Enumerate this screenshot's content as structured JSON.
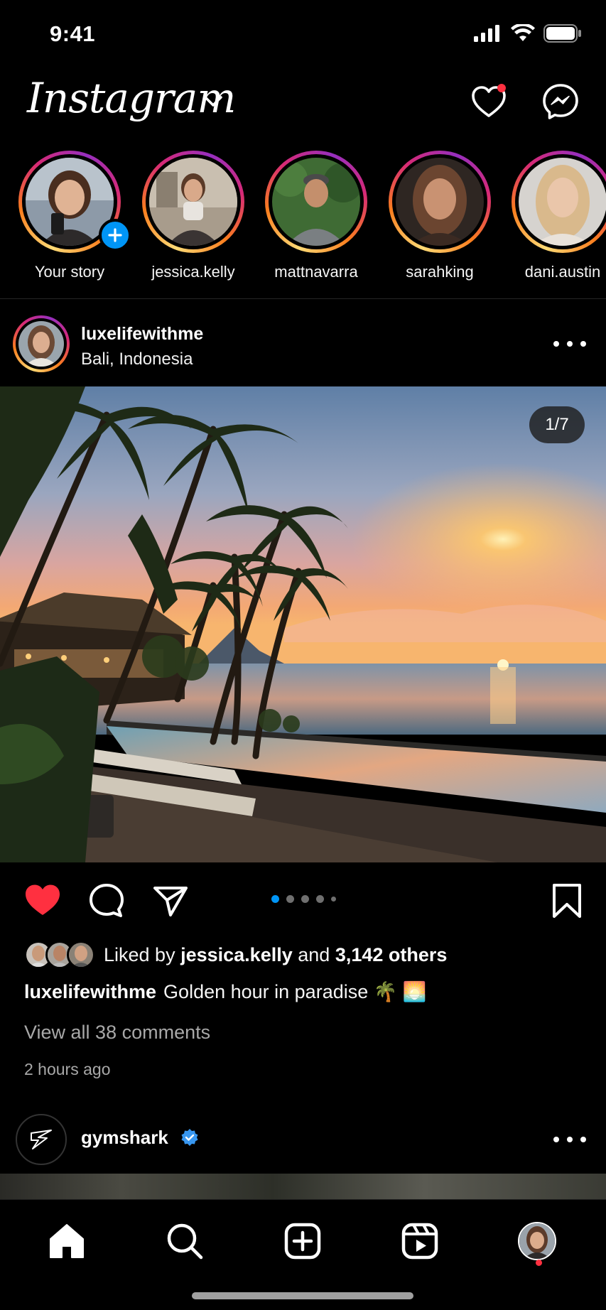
{
  "status_bar": {
    "time": "9:41"
  },
  "header": {
    "logo_text": "Instagram",
    "has_notification": true
  },
  "stories": [
    {
      "username": "Your story",
      "is_own": true,
      "seen": true
    },
    {
      "username": "jessica.kelly",
      "is_own": false,
      "seen": false
    },
    {
      "username": "mattnavarra",
      "is_own": false,
      "seen": false
    },
    {
      "username": "sarahking",
      "is_own": false,
      "seen": false
    },
    {
      "username": "dani.austin",
      "is_own": false,
      "seen": false
    }
  ],
  "post": {
    "username": "luxelifewithme",
    "location": "Bali, Indonesia",
    "image_counter": "1/7",
    "liked": true,
    "carousel_dots": 5,
    "carousel_active_index": 0,
    "likes_prefix": "Liked by",
    "likes_user": "jessica.kelly",
    "likes_and": "and",
    "likes_others": "3,142 others",
    "caption_user": "luxelifewithme",
    "caption_text": "Golden hour in paradise 🌴 🌅",
    "view_comments": "View all 38 comments",
    "timestamp": "2 hours ago"
  },
  "next_post": {
    "username": "gymshark",
    "verified": true
  },
  "tab_bar": {
    "items": [
      "home-icon",
      "search-icon",
      "create-icon",
      "reels-icon",
      "profile-avatar"
    ],
    "active": "home-icon",
    "profile_has_notification": true
  },
  "colors": {
    "background": "#000000",
    "like_red": "#ff3040",
    "accent_blue": "#0095f6",
    "secondary_text": "#a8a8a8"
  }
}
